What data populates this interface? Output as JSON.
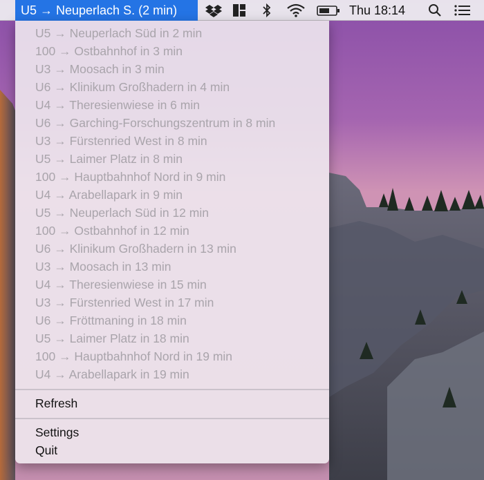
{
  "menubar": {
    "active_item": "U5 → Neuperlach S. (2 min)",
    "clock": "Thu 18:14",
    "icons": [
      "dropbox-icon",
      "window-layout-icon",
      "bluetooth-icon",
      "wifi-icon",
      "battery-icon",
      "spotlight-search-icon",
      "notification-center-icon"
    ]
  },
  "departures": [
    "U5 → Neuperlach Süd in 2 min",
    "100 → Ostbahnhof in 3 min",
    "U3 → Moosach in 3 min",
    "U6 → Klinikum Großhadern in 4 min",
    "U4 → Theresienwiese in 6 min",
    "U6 → Garching-Forschungszentrum in 8 min",
    "U3 → Fürstenried West in 8 min",
    "U5 → Laimer Platz in 8 min",
    "100 → Hauptbahnhof Nord in 9 min",
    "U4 → Arabellapark in 9 min",
    "U5 → Neuperlach Süd in 12 min",
    "100 → Ostbahnhof in 12 min",
    "U6 → Klinikum Großhadern in 13 min",
    "U3 → Moosach in 13 min",
    "U4 → Theresienwiese in 15 min",
    "U3 → Fürstenried West in 17 min",
    "U6 → Fröttmaning in 18 min",
    "U5 → Laimer Platz in 18 min",
    "100 → Hauptbahnhof Nord in 19 min",
    "U4 → Arabellapark in 19 min"
  ],
  "actions": {
    "refresh": "Refresh",
    "settings": "Settings",
    "quit": "Quit"
  },
  "colors": {
    "menubar_highlight": "#2474e5",
    "disabled_text": "#a9a4ab",
    "enabled_text": "#111111"
  }
}
